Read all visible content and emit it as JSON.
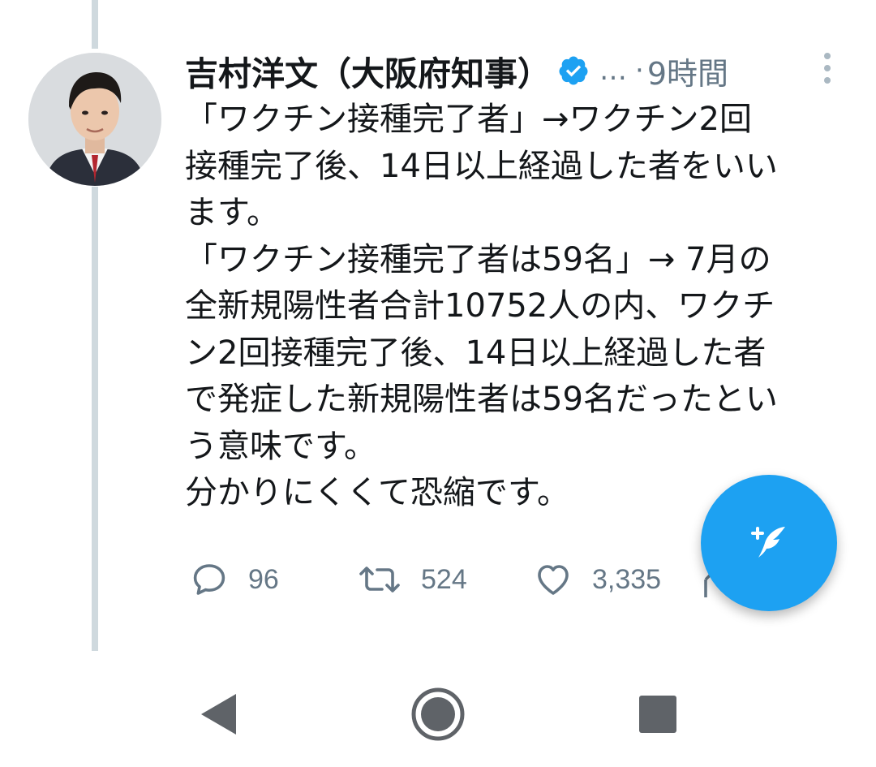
{
  "tweet": {
    "author_name": "吉村洋文（大阪府知事）",
    "handle_ellipsis": "…",
    "separator": "·",
    "timestamp": "9時間",
    "body_lines": [
      "「ワクチン接種完了者」→ワクチン2回",
      "接種完了後、14日以上経過した者をいい",
      "ます。",
      "「ワクチン接種完了者は59名」→ 7月の",
      "全新規陽性者合計10752人の内、ワクチ",
      "ン2回接種完了後、14日以上経過した者",
      "で発症した新規陽性者は59名だったとい",
      "う意味です。",
      "分かりにくくて恐縮です。"
    ],
    "reply_count": "96",
    "retweet_count": "524",
    "like_count": "3,335"
  },
  "icons": {
    "verified": "verified-badge-icon",
    "more": "more-vertical-icon",
    "reply": "reply-icon",
    "retweet": "retweet-icon",
    "like": "heart-icon",
    "share": "share-icon",
    "compose": "compose-tweet-icon",
    "nav_back": "back-triangle-icon",
    "nav_home": "home-circle-icon",
    "nav_recents": "recents-square-icon"
  },
  "colors": {
    "accent": "#1da1f2",
    "text": "#14171a",
    "secondary_text": "#657786",
    "thread_line": "#cfd9de",
    "nav_icons": "#5f6368"
  }
}
